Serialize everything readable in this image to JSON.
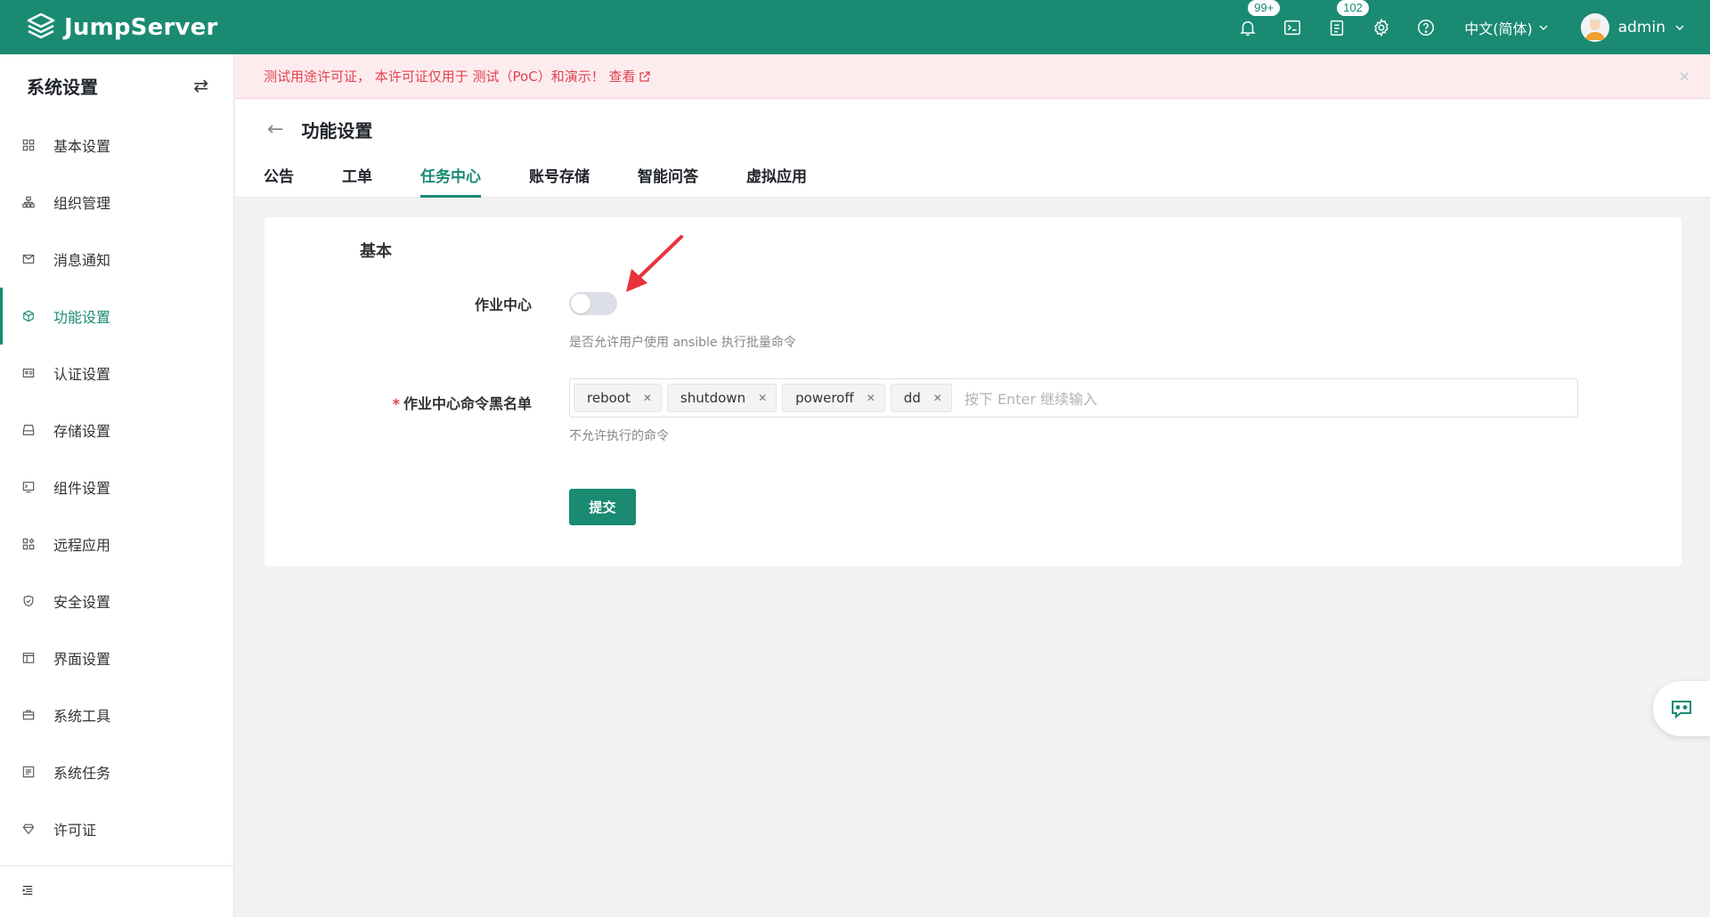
{
  "app": {
    "logo_text": "JumpServer"
  },
  "topbar": {
    "notifications_badge": "99+",
    "tickets_badge": "102",
    "language": "中文(简体)",
    "username": "admin"
  },
  "sidebar": {
    "title": "系统设置",
    "items": [
      {
        "label": "基本设置",
        "icon": "grid-icon"
      },
      {
        "label": "组织管理",
        "icon": "org-icon"
      },
      {
        "label": "消息通知",
        "icon": "message-icon"
      },
      {
        "label": "功能设置",
        "icon": "cube-icon",
        "active": true
      },
      {
        "label": "认证设置",
        "icon": "id-card-icon"
      },
      {
        "label": "存储设置",
        "icon": "storage-icon"
      },
      {
        "label": "组件设置",
        "icon": "terminal-icon"
      },
      {
        "label": "远程应用",
        "icon": "apps-icon"
      },
      {
        "label": "安全设置",
        "icon": "shield-icon"
      },
      {
        "label": "界面设置",
        "icon": "window-icon"
      },
      {
        "label": "系统工具",
        "icon": "toolbox-icon"
      },
      {
        "label": "系统任务",
        "icon": "task-icon"
      },
      {
        "label": "许可证",
        "icon": "diamond-icon"
      }
    ]
  },
  "alert": {
    "text": "测试用途许可证， 本许可证仅用于 测试（PoC）和演示！ 查看",
    "close": "×"
  },
  "page": {
    "title": "功能设置",
    "tabs": [
      "公告",
      "工单",
      "任务中心",
      "账号存储",
      "智能问答",
      "虚拟应用"
    ],
    "active_tab": "任务中心"
  },
  "form": {
    "section_title": "基本",
    "job_center_label": "作业中心",
    "job_center_enabled": false,
    "job_center_hint": "是否允许用户使用 ansible 执行批量命令",
    "blacklist_label": "作业中心命令黑名单",
    "blacklist_required": "*",
    "blacklist_tags": [
      "reboot",
      "shutdown",
      "poweroff",
      "dd"
    ],
    "blacklist_placeholder": "按下 Enter 继续输入",
    "blacklist_hint": "不允许执行的命令",
    "submit_label": "提交"
  },
  "colors": {
    "primary": "#1a8a73",
    "alert_bg": "#fdecee",
    "alert_text": "#e0424f",
    "annotation_arrow": "#e8333c"
  }
}
